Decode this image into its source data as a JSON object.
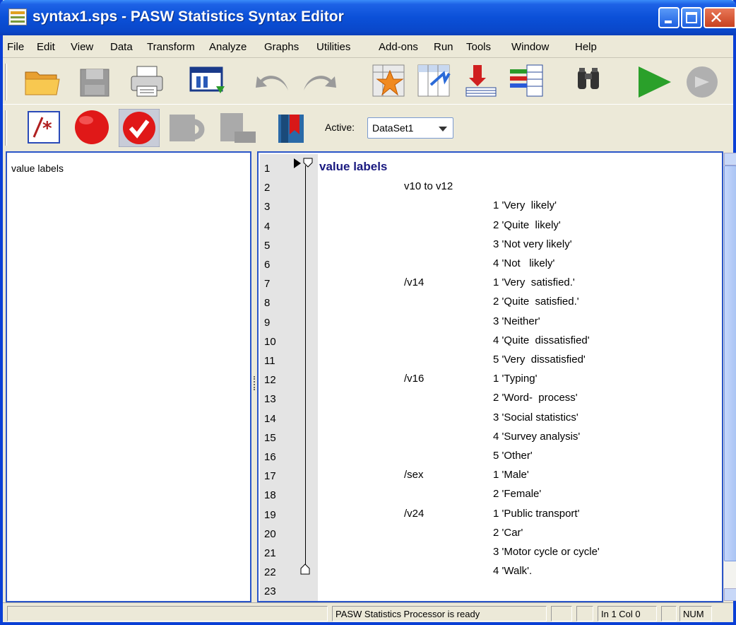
{
  "window": {
    "title": "syntax1.sps - PASW Statistics Syntax Editor"
  },
  "menu": {
    "items": [
      "File",
      "Edit",
      "View",
      "Data",
      "Transform",
      "Analyze",
      "Graphs",
      "Utilities",
      "Add-ons",
      "Run",
      "Tools",
      "Window",
      "Help"
    ]
  },
  "toolbar": {
    "icons": [
      "open-folder-icon",
      "save-icon",
      "print-icon",
      "dialog-recall-icon",
      "undo-icon",
      "redo-icon",
      "goto-case-icon",
      "goto-variable-icon",
      "variables-icon",
      "use-sets-icon",
      "find-icon",
      "run-icon",
      "stop-icon"
    ],
    "secondary_icons": [
      "comment-icon",
      "breakpoint-icon",
      "toggle-check-icon",
      "step-icon",
      "run-to-end-icon",
      "bookmark-icon"
    ],
    "active_label": "Active:",
    "active_dataset": "DataSet1"
  },
  "outline": {
    "items": [
      "value labels"
    ]
  },
  "editor": {
    "line_numbers": [
      "1",
      "2",
      "3",
      "4",
      "5",
      "6",
      "7",
      "8",
      "9",
      "10",
      "11",
      "12",
      "13",
      "14",
      "15",
      "16",
      "17",
      "18",
      "19",
      "20",
      "21",
      "22",
      "23"
    ],
    "lines": [
      {
        "a": "",
        "b": "value labels",
        "kw": true
      },
      {
        "a": "v10 to v12",
        "b": ""
      },
      {
        "a": "",
        "b": "1 'Very  likely'"
      },
      {
        "a": "",
        "b": "2 'Quite  likely'"
      },
      {
        "a": "",
        "b": "3 'Not very likely'"
      },
      {
        "a": "",
        "b": "4 'Not   likely'"
      },
      {
        "a": "/v14",
        "b": "1 'Very  satisfied.'"
      },
      {
        "a": "",
        "b": "2 'Quite  satisfied.'"
      },
      {
        "a": "",
        "b": "3 'Neither'"
      },
      {
        "a": "",
        "b": "4 'Quite  dissatisfied'"
      },
      {
        "a": "",
        "b": "5 'Very  dissatisfied'"
      },
      {
        "a": "/v16",
        "b": "1 'Typing'"
      },
      {
        "a": "",
        "b": "2 'Word-  process'"
      },
      {
        "a": "",
        "b": "3 'Social statistics'"
      },
      {
        "a": "",
        "b": "4 'Survey analysis'"
      },
      {
        "a": "",
        "b": "5 'Other'"
      },
      {
        "a": "/sex",
        "b": "1 'Male'"
      },
      {
        "a": "",
        "b": "2 'Female'"
      },
      {
        "a": "/v24",
        "b": "1 'Public transport'"
      },
      {
        "a": "",
        "b": "2 'Car'"
      },
      {
        "a": "",
        "b": "3 'Motor cycle or cycle'"
      },
      {
        "a": "",
        "b": "4 'Walk'."
      }
    ]
  },
  "status": {
    "processor": "PASW Statistics Processor is ready",
    "position": "In 1 Col 0",
    "num": "NUM"
  }
}
